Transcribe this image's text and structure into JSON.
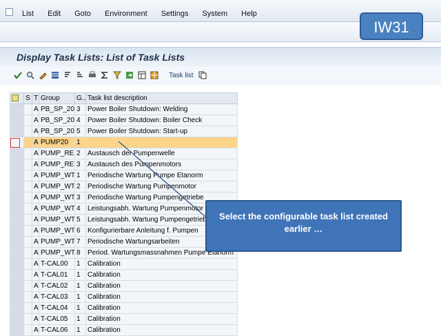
{
  "menu": [
    "List",
    "Edit",
    "Goto",
    "Environment",
    "Settings",
    "System",
    "Help"
  ],
  "transaction_badge": "IW31",
  "command_field": {
    "value": ""
  },
  "page_title": "Display Task Lists: List of Task Lists",
  "app_toolbar": {
    "task_list_label": "Task list"
  },
  "table": {
    "headers": [
      "S",
      "T",
      "Group",
      "G...",
      "Task list description"
    ],
    "rows": [
      {
        "t": "A",
        "group": "PB_SP_20",
        "g": "3",
        "desc": "Power Boiler Shutdown: Welding",
        "highlight": false,
        "current": false
      },
      {
        "t": "A",
        "group": "PB_SP_20",
        "g": "4",
        "desc": "Power Boiler Shutdown: Boiler Check",
        "highlight": false,
        "current": false
      },
      {
        "t": "A",
        "group": "PB_SP_20",
        "g": "5",
        "desc": "Power Boiler Shutdown: Start-up",
        "highlight": false,
        "current": false
      },
      {
        "t": "A",
        "group": "PUMP20",
        "g": "1",
        "desc": "",
        "highlight": true,
        "current": true
      },
      {
        "t": "A",
        "group": "PUMP_REP",
        "g": "2",
        "desc": "Austausch der Pumpenwelle",
        "highlight": false,
        "current": false
      },
      {
        "t": "A",
        "group": "PUMP_REP",
        "g": "3",
        "desc": "Austausch des Pumpenmotors",
        "highlight": false,
        "current": false
      },
      {
        "t": "A",
        "group": "PUMP_WT",
        "g": "1",
        "desc": "Periodische Wartung Pumpe Etanorm",
        "highlight": false,
        "current": false
      },
      {
        "t": "A",
        "group": "PUMP_WT",
        "g": "2",
        "desc": "Periodische Wartung Pumpenmotor",
        "highlight": false,
        "current": false
      },
      {
        "t": "A",
        "group": "PUMP_WT",
        "g": "3",
        "desc": "Periodische Wartung Pumpengetriebe",
        "highlight": false,
        "current": false
      },
      {
        "t": "A",
        "group": "PUMP_WT",
        "g": "4",
        "desc": "Leistungsabh. Wartung Pumpenmotor",
        "highlight": false,
        "current": false
      },
      {
        "t": "A",
        "group": "PUMP_WT",
        "g": "5",
        "desc": "Leistungsabh. Wartung Pumpengetriebe",
        "highlight": false,
        "current": false
      },
      {
        "t": "A",
        "group": "PUMP_WT",
        "g": "6",
        "desc": "Konfigurierbare Anleitung f. Pumpen",
        "highlight": false,
        "current": false
      },
      {
        "t": "A",
        "group": "PUMP_WT",
        "g": "7",
        "desc": "Periodische Wartungsarbeiten",
        "highlight": false,
        "current": false
      },
      {
        "t": "A",
        "group": "PUMP_WT",
        "g": "8",
        "desc": "Period. Wartungsmassnahmen Pumpe Etanorm",
        "highlight": false,
        "current": false
      },
      {
        "t": "A",
        "group": "T-CAL00",
        "g": "1",
        "desc": "Calibration",
        "highlight": false,
        "current": false
      },
      {
        "t": "A",
        "group": "T-CAL01",
        "g": "1",
        "desc": "Calibration",
        "highlight": false,
        "current": false
      },
      {
        "t": "A",
        "group": "T-CAL02",
        "g": "1",
        "desc": "Calibration",
        "highlight": false,
        "current": false
      },
      {
        "t": "A",
        "group": "T-CAL03",
        "g": "1",
        "desc": "Calibration",
        "highlight": false,
        "current": false
      },
      {
        "t": "A",
        "group": "T-CAL04",
        "g": "1",
        "desc": "Calibration",
        "highlight": false,
        "current": false
      },
      {
        "t": "A",
        "group": "T-CAL05",
        "g": "1",
        "desc": "Calibration",
        "highlight": false,
        "current": false
      },
      {
        "t": "A",
        "group": "T-CAL06",
        "g": "1",
        "desc": "Calibration",
        "highlight": false,
        "current": false
      }
    ]
  },
  "callout": {
    "text": "Select the configurable task list created earlier …"
  },
  "colors": {
    "highlight_row": "#fcd48a",
    "callout_bg": "#3f74b8",
    "badge_bg": "#4a81c1",
    "title_text": "#1f2f47"
  }
}
